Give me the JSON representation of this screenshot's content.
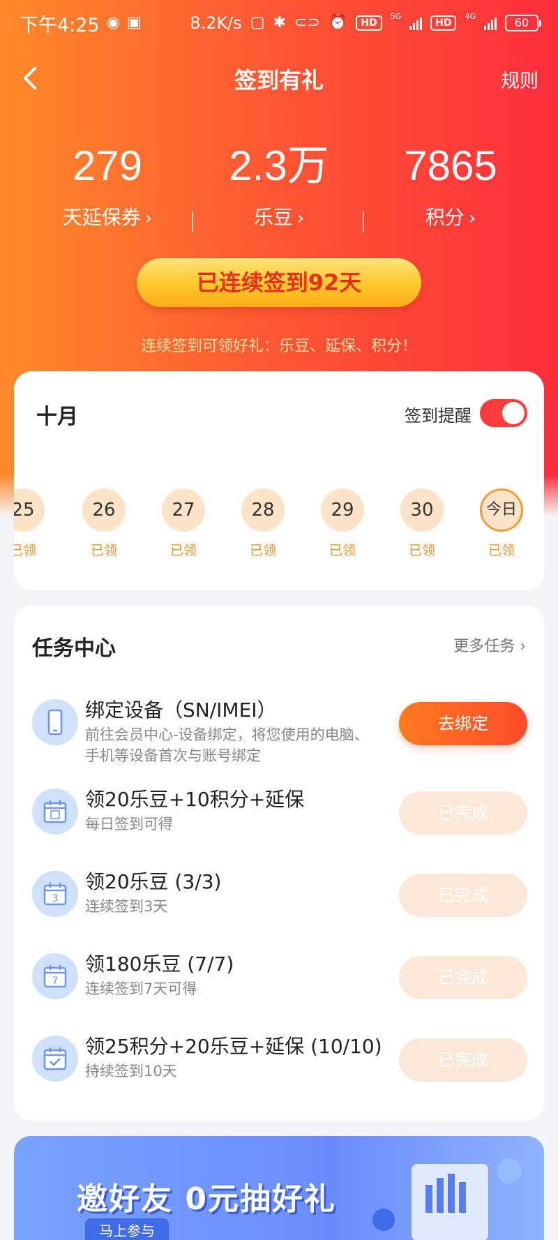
{
  "status_bar": {
    "time": "下午4:25",
    "speed": "8.2K/s",
    "network_5g": "5G",
    "network_4g": "4G",
    "hd_label": "HD",
    "battery": "60"
  },
  "nav": {
    "title": "签到有礼",
    "rules_label": "规则",
    "back_icon": "chevron-left-icon"
  },
  "stats": [
    {
      "value": "279",
      "label": "天延保券"
    },
    {
      "value": "2.3万",
      "label": "乐豆"
    },
    {
      "value": "7865",
      "label": "积分"
    }
  ],
  "streak": {
    "label": "已连续签到92天",
    "tip": "连续签到可领好礼：乐豆、延保、积分！"
  },
  "calendar": {
    "month": "十月",
    "reminder_label": "签到提醒",
    "reminder_on": true,
    "days": [
      {
        "label": "25",
        "status": "已领"
      },
      {
        "label": "26",
        "status": "已领"
      },
      {
        "label": "27",
        "status": "已领"
      },
      {
        "label": "28",
        "status": "已领"
      },
      {
        "label": "29",
        "status": "已领"
      },
      {
        "label": "30",
        "status": "已领"
      },
      {
        "label": "今日",
        "status": "已领"
      }
    ]
  },
  "tasks": {
    "title": "任务中心",
    "more_label": "更多任务 ›",
    "items": [
      {
        "title": "绑定设备（SN/IMEI）",
        "desc": "前往会员中心-设备绑定，将您使用的电脑、手机等设备首次与账号绑定",
        "button": "去绑定",
        "state": "active",
        "icon": "phone-icon"
      },
      {
        "title": "领20乐豆+10积分+延保",
        "desc": "每日签到可得",
        "button": "已完成",
        "state": "done",
        "icon": "calendar-sign-icon"
      },
      {
        "title": "领20乐豆 (3/3)",
        "desc": "连续签到3天",
        "button": "已完成",
        "state": "done",
        "icon": "calendar-3-icon"
      },
      {
        "title": "领180乐豆 (7/7)",
        "desc": "连续签到7天可得",
        "button": "已完成",
        "state": "done",
        "icon": "calendar-7-icon"
      },
      {
        "title": "领25积分+20乐豆+延保 (10/10)",
        "desc": "持续签到10天",
        "button": "已完成",
        "state": "done",
        "icon": "calendar-check-icon"
      }
    ]
  },
  "banner": {
    "title": "邀好友 0元抽好礼",
    "join_label": "马上参与"
  },
  "colors": {
    "accent_orange": "#ff7a1e",
    "accent_red": "#ff2e3c",
    "done_button": "#fde8d8",
    "day_circle": "#fde3c8"
  }
}
